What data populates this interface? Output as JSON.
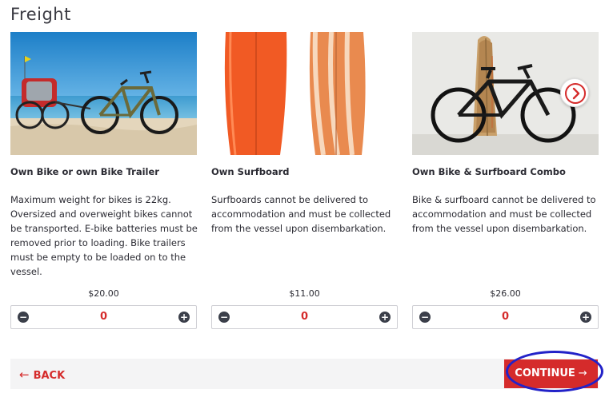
{
  "page": {
    "title": "Freight"
  },
  "products": [
    {
      "title": "Own Bike or own Bike Trailer",
      "description": "Maximum weight for bikes is 22kg. Oversized and overweight bikes cannot be transported. E-bike batteries must be removed prior to loading. Bike trailers must be empty to be loaded on to the vessel.",
      "price": "$20.00",
      "quantity": "0",
      "minus_symbol": "−",
      "plus_symbol": "+"
    },
    {
      "title": "Own Surfboard",
      "description": "Surfboards cannot be delivered to accommodation and must be collected from the vessel upon disembarkation.",
      "price": "$11.00",
      "quantity": "0",
      "minus_symbol": "−",
      "plus_symbol": "+"
    },
    {
      "title": "Own Bike & Surfboard Combo",
      "description": "Bike & surfboard cannot be delivered to accommodation and must be collected from the vessel upon disembarkation.",
      "price": "$26.00",
      "quantity": "0",
      "minus_symbol": "−",
      "plus_symbol": "+"
    }
  ],
  "carousel": {
    "next_icon": "chevron-right-icon"
  },
  "footer": {
    "back_label": "BACK",
    "back_arrow": "←",
    "continue_label": "CONTINUE",
    "continue_arrow": "→"
  },
  "colors": {
    "accent": "#d52b2b",
    "stepper_button": "#3b3f4a",
    "footer_bg": "#f4f4f5",
    "annotation": "#2222c8"
  }
}
